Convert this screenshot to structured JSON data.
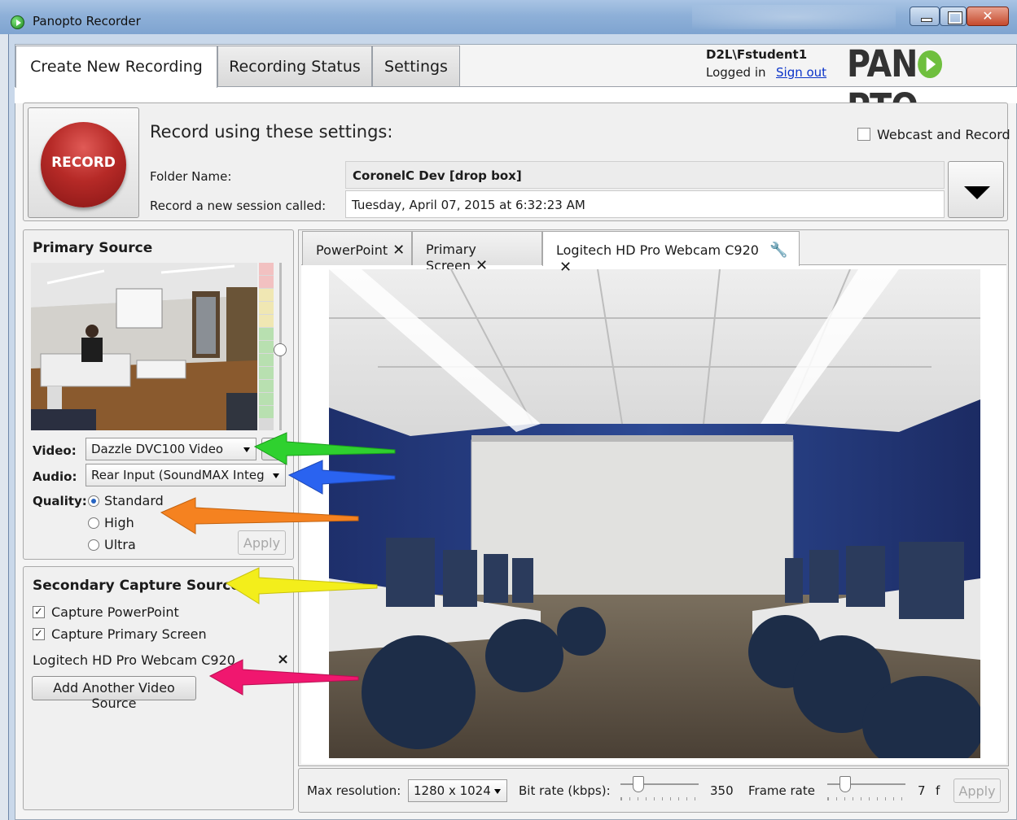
{
  "window": {
    "title": "Panopto Recorder"
  },
  "tabs": [
    {
      "label": "Create New Recording"
    },
    {
      "label": "Recording Status"
    },
    {
      "label": "Settings"
    }
  ],
  "user": {
    "name": "D2L\\Fstudent1",
    "status": "Logged in",
    "sign_out": "Sign out"
  },
  "logo": {
    "left": "PAN",
    "right": "PTO",
    "icon": "play-icon",
    "color": "#6fbf3e"
  },
  "record": {
    "button_label": "RECORD",
    "heading": "Record using these settings:",
    "webcast_label": "Webcast and Record",
    "folder_label": "Folder Name:",
    "folder_value": "CoronelC Dev [drop box]",
    "session_label": "Record a new session called:",
    "session_value": "Tuesday, April 07, 2015 at 6:32:23 AM"
  },
  "primary_source": {
    "title": "Primary Source",
    "video_label": "Video:",
    "video_value": "Dazzle DVC100 Video",
    "audio_label": "Audio:",
    "audio_value": "Rear Input (SoundMAX Integ",
    "quality_label": "Quality:",
    "quality_options": [
      "Standard",
      "High",
      "Ultra"
    ],
    "quality_selected": "Standard",
    "apply_label": "Apply"
  },
  "secondary_sources": {
    "title": "Secondary Capture Sources",
    "items": [
      {
        "label": "Capture PowerPoint",
        "checked": true
      },
      {
        "label": "Capture Primary Screen",
        "checked": true
      }
    ],
    "extra_source": "Logitech HD Pro Webcam C920",
    "remove_symbol": "×",
    "add_button": "Add Another Video Source"
  },
  "source_tabs": [
    {
      "label": "PowerPoint"
    },
    {
      "label": "Primary Screen"
    },
    {
      "label": "Logitech HD Pro Webcam C920",
      "active": true
    }
  ],
  "bottom_bar": {
    "max_resolution_label": "Max resolution:",
    "max_resolution_value": "1280 x 1024",
    "bitrate_label": "Bit rate (kbps):",
    "bitrate_value": "350",
    "framerate_label": "Frame rate",
    "framerate_value": "7",
    "framerate_unit": "f",
    "apply_label": "Apply"
  },
  "colors": {
    "record_red": "#b62a27",
    "link_blue": "#0a33c9",
    "annotation_green": "#2fd12f",
    "annotation_blue": "#2a63f0",
    "annotation_orange": "#f58220",
    "annotation_yellow": "#f3ee1b",
    "annotation_pink": "#f0176f"
  }
}
